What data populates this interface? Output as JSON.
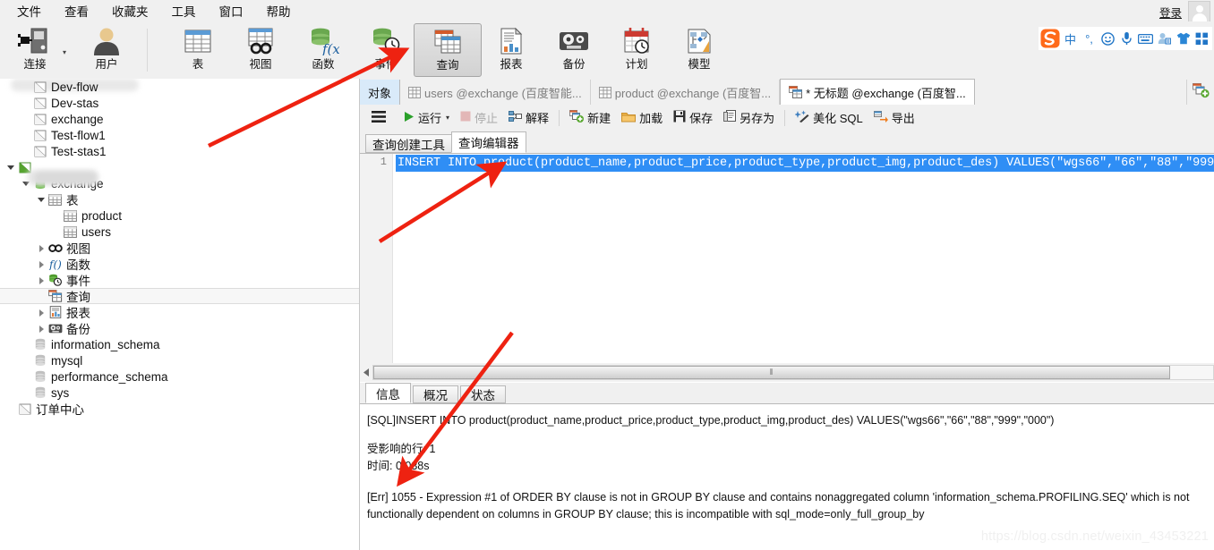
{
  "menu": {
    "items": [
      "文件",
      "查看",
      "收藏夹",
      "工具",
      "窗口",
      "帮助"
    ],
    "login_label": "登录"
  },
  "ribbon": {
    "buttons": [
      {
        "label": "连接",
        "icon": "connection-icon",
        "has_dropdown": true
      },
      {
        "label": "用户",
        "icon": "user-icon",
        "has_dropdown": false
      },
      {
        "label": "表",
        "icon": "table-icon",
        "has_dropdown": false
      },
      {
        "label": "视图",
        "icon": "view-icon",
        "has_dropdown": false
      },
      {
        "label": "函数",
        "icon": "function-icon",
        "has_dropdown": false
      },
      {
        "label": "事件",
        "icon": "event-icon",
        "has_dropdown": false
      },
      {
        "label": "查询",
        "icon": "query-icon",
        "has_dropdown": false,
        "selected": true
      },
      {
        "label": "报表",
        "icon": "report-icon",
        "has_dropdown": false
      },
      {
        "label": "备份",
        "icon": "backup-icon",
        "has_dropdown": false
      },
      {
        "label": "计划",
        "icon": "schedule-icon",
        "has_dropdown": false
      },
      {
        "label": "模型",
        "icon": "model-icon",
        "has_dropdown": false
      }
    ]
  },
  "sidebar": {
    "tree": [
      {
        "label": "Dev-flow",
        "icon": "connection-node-icon",
        "indent": 1,
        "expander": "none",
        "clipped": true
      },
      {
        "label": "Dev-stas",
        "icon": "connection-node-icon",
        "indent": 1,
        "expander": "none"
      },
      {
        "label": "exchange",
        "icon": "connection-node-icon",
        "indent": 1,
        "expander": "none"
      },
      {
        "label": "Test-flow1",
        "icon": "connection-node-icon",
        "indent": 1,
        "expander": "none"
      },
      {
        "label": "Test-stas1",
        "icon": "connection-node-icon",
        "indent": 1,
        "expander": "none",
        "clipped": true
      },
      {
        "label": "",
        "icon": "connection-node-green-icon",
        "indent": 0,
        "expander": "open",
        "redacted": true
      },
      {
        "label": "exchange",
        "icon": "database-icon",
        "indent": 1,
        "expander": "open"
      },
      {
        "label": "表",
        "icon": "tables-folder-icon",
        "indent": 2,
        "expander": "open"
      },
      {
        "label": "product",
        "icon": "table-node-icon",
        "indent": 3,
        "expander": "none"
      },
      {
        "label": "users",
        "icon": "table-node-icon",
        "indent": 3,
        "expander": "none"
      },
      {
        "label": "视图",
        "icon": "views-folder-icon",
        "indent": 2,
        "expander": "closed"
      },
      {
        "label": "函数",
        "icon": "functions-folder-icon",
        "indent": 2,
        "expander": "closed"
      },
      {
        "label": "事件",
        "icon": "events-folder-icon",
        "indent": 2,
        "expander": "closed"
      },
      {
        "label": "查询",
        "icon": "queries-folder-icon",
        "indent": 2,
        "expander": "none",
        "selected": true
      },
      {
        "label": "报表",
        "icon": "reports-folder-icon",
        "indent": 2,
        "expander": "closed"
      },
      {
        "label": "备份",
        "icon": "backups-folder-icon",
        "indent": 2,
        "expander": "closed"
      },
      {
        "label": "information_schema",
        "icon": "database-gray-icon",
        "indent": 1,
        "expander": "none"
      },
      {
        "label": "mysql",
        "icon": "database-gray-icon",
        "indent": 1,
        "expander": "none"
      },
      {
        "label": "performance_schema",
        "icon": "database-gray-icon",
        "indent": 1,
        "expander": "none"
      },
      {
        "label": "sys",
        "icon": "database-gray-icon",
        "indent": 1,
        "expander": "none"
      },
      {
        "label": "订单中心",
        "icon": "connection-node-icon",
        "indent": 0,
        "expander": "none"
      }
    ]
  },
  "tabs": {
    "object_tab": "对象",
    "open_tabs": [
      {
        "label": "users @exchange (百度智能...",
        "icon": "table-tab-icon",
        "active": false
      },
      {
        "label": "product @exchange (百度智...",
        "icon": "table-tab-icon",
        "active": false
      },
      {
        "label": "* 无标题 @exchange (百度智...",
        "icon": "query-tab-icon",
        "active": true
      }
    ],
    "new_tab_icon": "new-query-plus-icon"
  },
  "query_toolbar": {
    "menu_icon": "hamburger-menu-icon",
    "buttons": [
      {
        "label": "运行",
        "icon": "run-play-icon",
        "dropdown": true,
        "disabled": false
      },
      {
        "label": "停止",
        "icon": "stop-square-icon",
        "dropdown": false,
        "disabled": true
      },
      {
        "label": "解释",
        "icon": "explain-icon",
        "dropdown": false,
        "disabled": false
      },
      {
        "label": "新建",
        "icon": "new-file-icon",
        "dropdown": false,
        "disabled": false
      },
      {
        "label": "加载",
        "icon": "load-folder-icon",
        "dropdown": false,
        "disabled": false
      },
      {
        "label": "保存",
        "icon": "save-disk-icon",
        "dropdown": false,
        "disabled": false
      },
      {
        "label": "另存为",
        "icon": "save-as-icon",
        "dropdown": false,
        "disabled": false
      },
      {
        "label": "美化 SQL",
        "icon": "beautify-sparkle-icon",
        "dropdown": false,
        "disabled": false
      },
      {
        "label": "导出",
        "icon": "export-arrow-icon",
        "dropdown": false,
        "disabled": false
      }
    ]
  },
  "sub_tabs": [
    {
      "label": "查询创建工具",
      "active": false
    },
    {
      "label": "查询编辑器",
      "active": true
    }
  ],
  "editor": {
    "line_number": "1",
    "sql": "INSERT INTO product(product_name,product_price,product_type,product_img,product_des) VALUES(\"wgs66\",\"66\",\"88\",\"999",
    "selection_color": "#2f8ef5",
    "scroll_grip": "⦀"
  },
  "result_tabs": [
    {
      "label": "信息",
      "active": true
    },
    {
      "label": "概况",
      "active": false
    },
    {
      "label": "状态",
      "active": false
    }
  ],
  "messages": {
    "sql_line": "[SQL]INSERT INTO product(product_name,product_price,product_type,product_img,product_des) VALUES(\"wgs66\",\"66\",\"88\",\"999\",\"000\")",
    "affected_rows": "受影响的行: 1",
    "time": "时间: 0.038s",
    "error": "[Err] 1055 - Expression #1 of ORDER BY clause is not in GROUP BY clause and contains nonaggregated column 'information_schema.PROFILING.SEQ' which is not functionally dependent on columns in GROUP BY clause; this is incompatible with sql_mode=only_full_group_by"
  },
  "ime": {
    "logo": "sogou-logo-icon",
    "items": [
      "中",
      "°,",
      "☺",
      "🎤",
      "⌨",
      "👤",
      "👕",
      "▦"
    ]
  },
  "watermark": "https://blog.csdn.net/weixin_43453221",
  "colors": {
    "accent": "#2f8ef5",
    "ribbon_bg": "#f0f0f0",
    "green": "#66a84a",
    "arrow_red": "#ee2211"
  }
}
